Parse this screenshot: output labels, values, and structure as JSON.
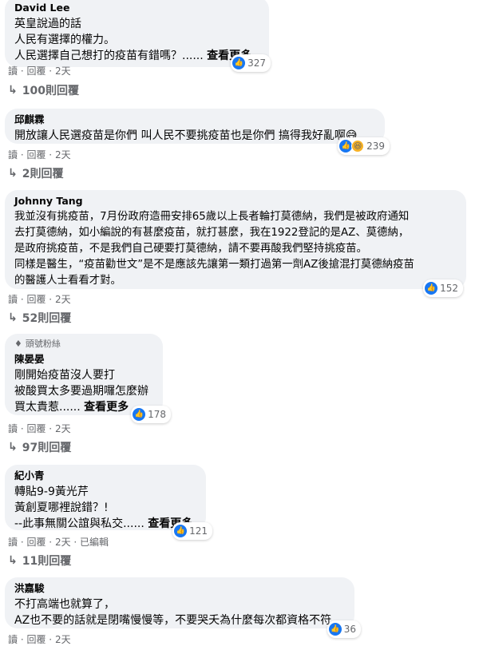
{
  "comments": [
    {
      "author": "David Lee",
      "lines": [
        "英皇說過的話",
        "人民有選擇的權力。",
        "人民選擇自己想打的疫苗有錯嗎？......"
      ],
      "see_more": "查看更多",
      "reaction_count": "327",
      "read": "讀",
      "reply": "回覆",
      "time": "2天",
      "replies_label": "100則回覆"
    },
    {
      "author": "邱麒霖",
      "lines": [
        "開放讓人民選疫苗是你們 叫人民不要挑疫苗也是你們 搞得我好亂啊😅"
      ],
      "reaction_count": "239",
      "read": "讀",
      "reply": "回覆",
      "time": "2天",
      "replies_label": "2則回覆"
    },
    {
      "author": "Johnny Tang",
      "lines": [
        "我並沒有挑疫苗，7月份政府造冊安排65歲以上長者輪打莫德納，我們是被政府通知",
        "去打莫德納，如小編說的有甚麼疫苗，就打甚麼，我在1922登記的是AZ、莫德納，",
        "是政府挑疫苗，不是我們自己硬要打莫德納，請不要再酸我們堅持挑疫苗。",
        "同樣是醫生，“疫苗勸世文”是不是應該先讓第一類打過第一劑AZ後搶混打莫德納疫苗",
        "的醫護人士看看才對。"
      ],
      "reaction_count": "152",
      "read": "讀",
      "reply": "回覆",
      "time": "2天",
      "replies_label": "52則回覆"
    },
    {
      "badge": "頭號粉絲",
      "author": "陳晏晏",
      "lines": [
        "剛開始疫苗沒人要打",
        "被酸買太多要過期囉怎麼辦",
        "買太貴惹......"
      ],
      "see_more": "查看更多",
      "reaction_count": "178",
      "read": "讀",
      "reply": "回覆",
      "time": "2天",
      "replies_label": "97則回覆"
    },
    {
      "author": "紀小青",
      "lines": [
        "轉貼9-9黃光芹",
        "黃創夏哪裡說錯？!",
        "--此事無關公誼與私交......"
      ],
      "see_more": "查看更多",
      "reaction_count": "121",
      "read": "讀",
      "reply": "回覆",
      "time": "2天",
      "edited": "已編輯",
      "replies_label": "11則回覆"
    },
    {
      "author": "洪嘉駿",
      "lines": [
        "不打高端也就算了，",
        "AZ也不要的話就是閉嘴慢慢等，不要哭夭為什麼每次都資格不符"
      ],
      "reaction_count": "36",
      "read": "讀",
      "reply": "回覆",
      "time": "2天"
    }
  ]
}
